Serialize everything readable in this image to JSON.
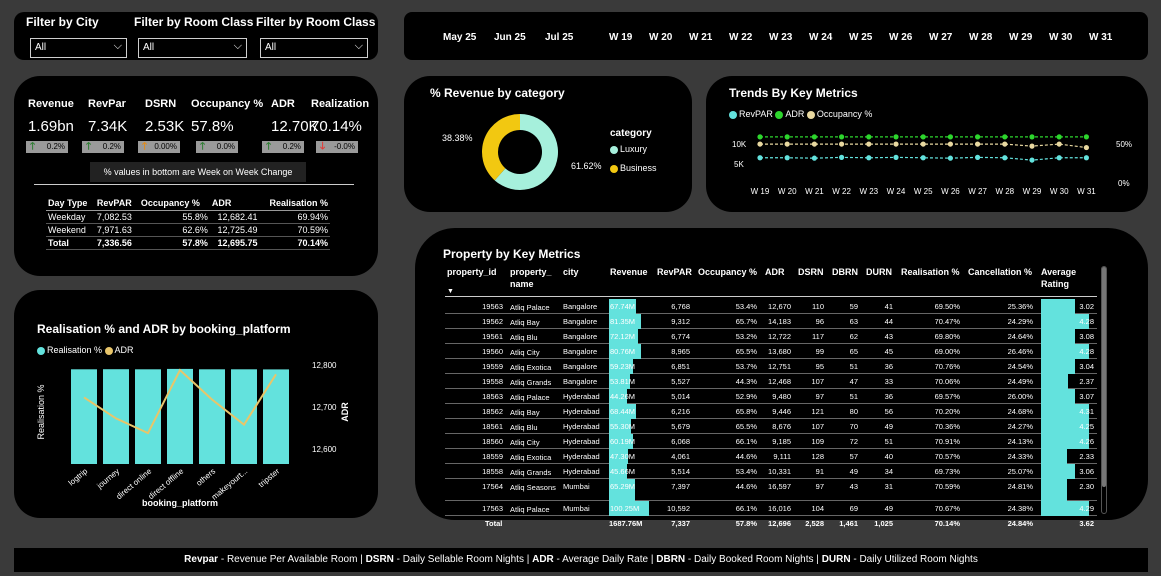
{
  "filters": [
    {
      "title": "Filter by City",
      "value": "All"
    },
    {
      "title": "Filter by Room Class",
      "value": "All"
    },
    {
      "title": "Filter by Room Class",
      "value": "All"
    }
  ],
  "dates": [
    "May 25",
    "Jun 25",
    "Jul 25",
    "W 19",
    "W 20",
    "W 21",
    "W 22",
    "W 23",
    "W 24",
    "W 25",
    "W 26",
    "W 27",
    "W 28",
    "W 29",
    "W 30",
    "W 31"
  ],
  "kpis": [
    {
      "label": "Revenue",
      "value": "1.69bn",
      "change": "0.2%",
      "dir": "up"
    },
    {
      "label": "RevPar",
      "value": "7.34K",
      "change": "0.2%",
      "dir": "up"
    },
    {
      "label": "DSRN",
      "value": "2.53K",
      "change": "0.00%",
      "dir": "up"
    },
    {
      "label": "Occupancy %",
      "value": "57.8%",
      "change": "0.0%",
      "dir": "up"
    },
    {
      "label": "ADR",
      "value": "12.70K",
      "change": "0.2%",
      "dir": "up"
    },
    {
      "label": "Realization",
      "value": "70.14%",
      "change": "-0.0%",
      "dir": "down"
    }
  ],
  "kpi_note": "% values in bottom are Week on Week Change",
  "daytype": {
    "headers": [
      "Day Type",
      "RevPAR",
      "Occupancy %",
      "ADR",
      "Realisation %"
    ],
    "rows": [
      [
        "Weekday",
        "7,082.53",
        "55.8%",
        "12,682.41",
        "69.94%"
      ],
      [
        "Weekend",
        "7,971.63",
        "62.6%",
        "12,725.49",
        "70.59%"
      ],
      [
        "Total",
        "7,336.56",
        "57.8%",
        "12,695.75",
        "70.14%"
      ]
    ]
  },
  "revenue_category": {
    "title": "% Revenue by category",
    "legend_title": "category",
    "colors": {
      "Luxury": "#a6f0dc",
      "Business": "#f2c811"
    }
  },
  "trends": {
    "title": "Trends By Key Metrics",
    "legend": [
      "RevPAR",
      "ADR",
      "Occupancy %"
    ],
    "colors": {
      "RevPAR": "#63e2dd",
      "ADR": "#2dd62d",
      "Occupancy": "#e8d8a0"
    },
    "left_ticks": [
      "10K",
      "5K"
    ],
    "right_ticks": [
      "50%",
      "0%"
    ]
  },
  "realisation_chart": {
    "title": "Realisation % and ADR by booking_platform",
    "legend": [
      "Realisation %",
      "ADR"
    ],
    "right_ticks": [
      "12,800",
      "12,700",
      "12,600"
    ],
    "colors": {
      "bar": "#63e2dd",
      "line": "#e8c56a"
    }
  },
  "chart_data": [
    {
      "type": "pie",
      "title": "% Revenue by category",
      "categories": [
        "Luxury",
        "Business"
      ],
      "values": [
        61.62,
        38.38
      ],
      "labels": [
        "61.62%",
        "38.38%"
      ],
      "legend_title": "category"
    },
    {
      "type": "line",
      "title": "Trends By Key Metrics",
      "categories": [
        "W 19",
        "W 20",
        "W 21",
        "W 22",
        "W 23",
        "W 24",
        "W 25",
        "W 26",
        "W 27",
        "W 28",
        "W 29",
        "W 30",
        "W 31"
      ],
      "series": [
        {
          "name": "RevPAR",
          "axis": "left",
          "values": [
            7300,
            7300,
            7200,
            7400,
            7300,
            7400,
            7300,
            7200,
            7400,
            7300,
            6700,
            7300,
            7300
          ]
        },
        {
          "name": "ADR",
          "axis": "left",
          "values": [
            12700,
            12700,
            12700,
            12700,
            12700,
            12700,
            12700,
            12700,
            12700,
            12700,
            12700,
            12700,
            12700
          ]
        },
        {
          "name": "Occupancy %",
          "axis": "right",
          "values": [
            57.8,
            57.8,
            57.8,
            57.8,
            57.8,
            57.8,
            57.8,
            57.8,
            57.8,
            57.8,
            55,
            57.8,
            53
          ]
        }
      ],
      "ylim_left": [
        0,
        15000
      ],
      "ylim_right": [
        0,
        80
      ]
    },
    {
      "type": "bar",
      "title": "Realisation % and ADR by booking_platform",
      "xlabel": "booking_platform",
      "ylabel": "Realisation %",
      "ylabel_right": "ADR",
      "categories": [
        "logtrip",
        "journey",
        "direct online",
        "direct offline",
        "others",
        "makeyourt...",
        "tripster"
      ],
      "series": [
        {
          "name": "Realisation %",
          "type": "bar",
          "values": [
            70.1,
            70.2,
            70.1,
            70.5,
            70.1,
            70.1,
            70.0
          ]
        },
        {
          "name": "ADR",
          "type": "line",
          "axis": "right",
          "values": [
            12730,
            12680,
            12645,
            12795,
            12725,
            12665,
            12785
          ]
        }
      ],
      "ylim": [
        0,
        100
      ],
      "ylim_right": [
        12600,
        12800
      ]
    }
  ],
  "property": {
    "title": "Property by Key Metrics",
    "headers": [
      "property_id",
      "property_name",
      "city",
      "Revenue",
      "RevPAR",
      "Occupancy %",
      "ADR",
      "DSRN",
      "DBRN",
      "DURN",
      "Realisation %",
      "Cancellation %",
      "Average Rating"
    ],
    "header_display": [
      "property_id",
      "property_\nname",
      "city",
      "Revenue",
      "RevPAR",
      "Occupancy %",
      "ADR",
      "DSRN",
      "DBRN",
      "DURN",
      "Realisation %",
      "Cancellation %",
      "Average\nRating"
    ],
    "rows": [
      [
        "19563",
        "Atliq Palace",
        "Bangalore",
        "67.74M",
        "6,768",
        "53.4%",
        "12,670",
        "110",
        "59",
        "41",
        "69.50%",
        "25.36%",
        "3.02"
      ],
      [
        "19562",
        "Atliq Bay",
        "Bangalore",
        "81.35M",
        "9,312",
        "65.7%",
        "14,183",
        "96",
        "63",
        "44",
        "70.47%",
        "24.29%",
        "4.28"
      ],
      [
        "19561",
        "Atliq Blu",
        "Bangalore",
        "72.12M",
        "6,774",
        "53.2%",
        "12,722",
        "117",
        "62",
        "43",
        "69.80%",
        "24.64%",
        "3.08"
      ],
      [
        "19560",
        "Atliq City",
        "Bangalore",
        "80.76M",
        "8,965",
        "65.5%",
        "13,680",
        "99",
        "65",
        "45",
        "69.00%",
        "26.46%",
        "4.28"
      ],
      [
        "19559",
        "Atliq Exotica",
        "Bangalore",
        "59.23M",
        "6,851",
        "53.7%",
        "12,751",
        "95",
        "51",
        "36",
        "70.76%",
        "24.54%",
        "3.04"
      ],
      [
        "19558",
        "Atliq Grands",
        "Bangalore",
        "53.81M",
        "5,527",
        "44.3%",
        "12,468",
        "107",
        "47",
        "33",
        "70.06%",
        "24.49%",
        "2.37"
      ],
      [
        "18563",
        "Atliq Palace",
        "Hyderabad",
        "44.26M",
        "5,014",
        "52.9%",
        "9,480",
        "97",
        "51",
        "36",
        "69.57%",
        "26.00%",
        "3.07"
      ],
      [
        "18562",
        "Atliq Bay",
        "Hyderabad",
        "68.44M",
        "6,216",
        "65.8%",
        "9,446",
        "121",
        "80",
        "56",
        "70.20%",
        "24.68%",
        "4.31"
      ],
      [
        "18561",
        "Atliq Blu",
        "Hyderabad",
        "55.30M",
        "5,679",
        "65.5%",
        "8,676",
        "107",
        "70",
        "49",
        "70.36%",
        "24.27%",
        "4.25"
      ],
      [
        "18560",
        "Atliq City",
        "Hyderabad",
        "60.19M",
        "6,068",
        "66.1%",
        "9,185",
        "109",
        "72",
        "51",
        "70.91%",
        "24.13%",
        "4.26"
      ],
      [
        "18559",
        "Atliq Exotica",
        "Hyderabad",
        "47.30M",
        "4,061",
        "44.6%",
        "9,111",
        "128",
        "57",
        "40",
        "70.57%",
        "24.33%",
        "2.33"
      ],
      [
        "18558",
        "Atliq Grands",
        "Hyderabad",
        "45.66M",
        "5,514",
        "53.4%",
        "10,331",
        "91",
        "49",
        "34",
        "69.73%",
        "25.07%",
        "3.06"
      ],
      [
        "17564",
        "Atliq Seasons",
        "Mumbai",
        "65.29M",
        "7,397",
        "44.6%",
        "16,597",
        "97",
        "43",
        "31",
        "70.59%",
        "24.81%",
        "2.30"
      ],
      [
        "17563",
        "Atliq Palace",
        "Mumbai",
        "100.25M",
        "10,592",
        "66.1%",
        "16,016",
        "104",
        "69",
        "49",
        "70.67%",
        "24.38%",
        "4.29"
      ]
    ],
    "total": [
      "Total",
      "",
      "",
      "1687.76M",
      "7,337",
      "57.8%",
      "12,696",
      "2,528",
      "1,461",
      "1,025",
      "70.14%",
      "24.84%",
      "3.62"
    ]
  },
  "footer": [
    {
      "term": "Revpar",
      "desc": " - Revenue Per Available Room | "
    },
    {
      "term": "DSRN",
      "desc": " - Daily Sellable Room Nights | "
    },
    {
      "term": "ADR",
      "desc": " - Average Daily Rate | "
    },
    {
      "term": "DBRN",
      "desc": " - Daily Booked Room Nights | "
    },
    {
      "term": "DURN",
      "desc": " - Daily Utilized Room Nights"
    }
  ]
}
